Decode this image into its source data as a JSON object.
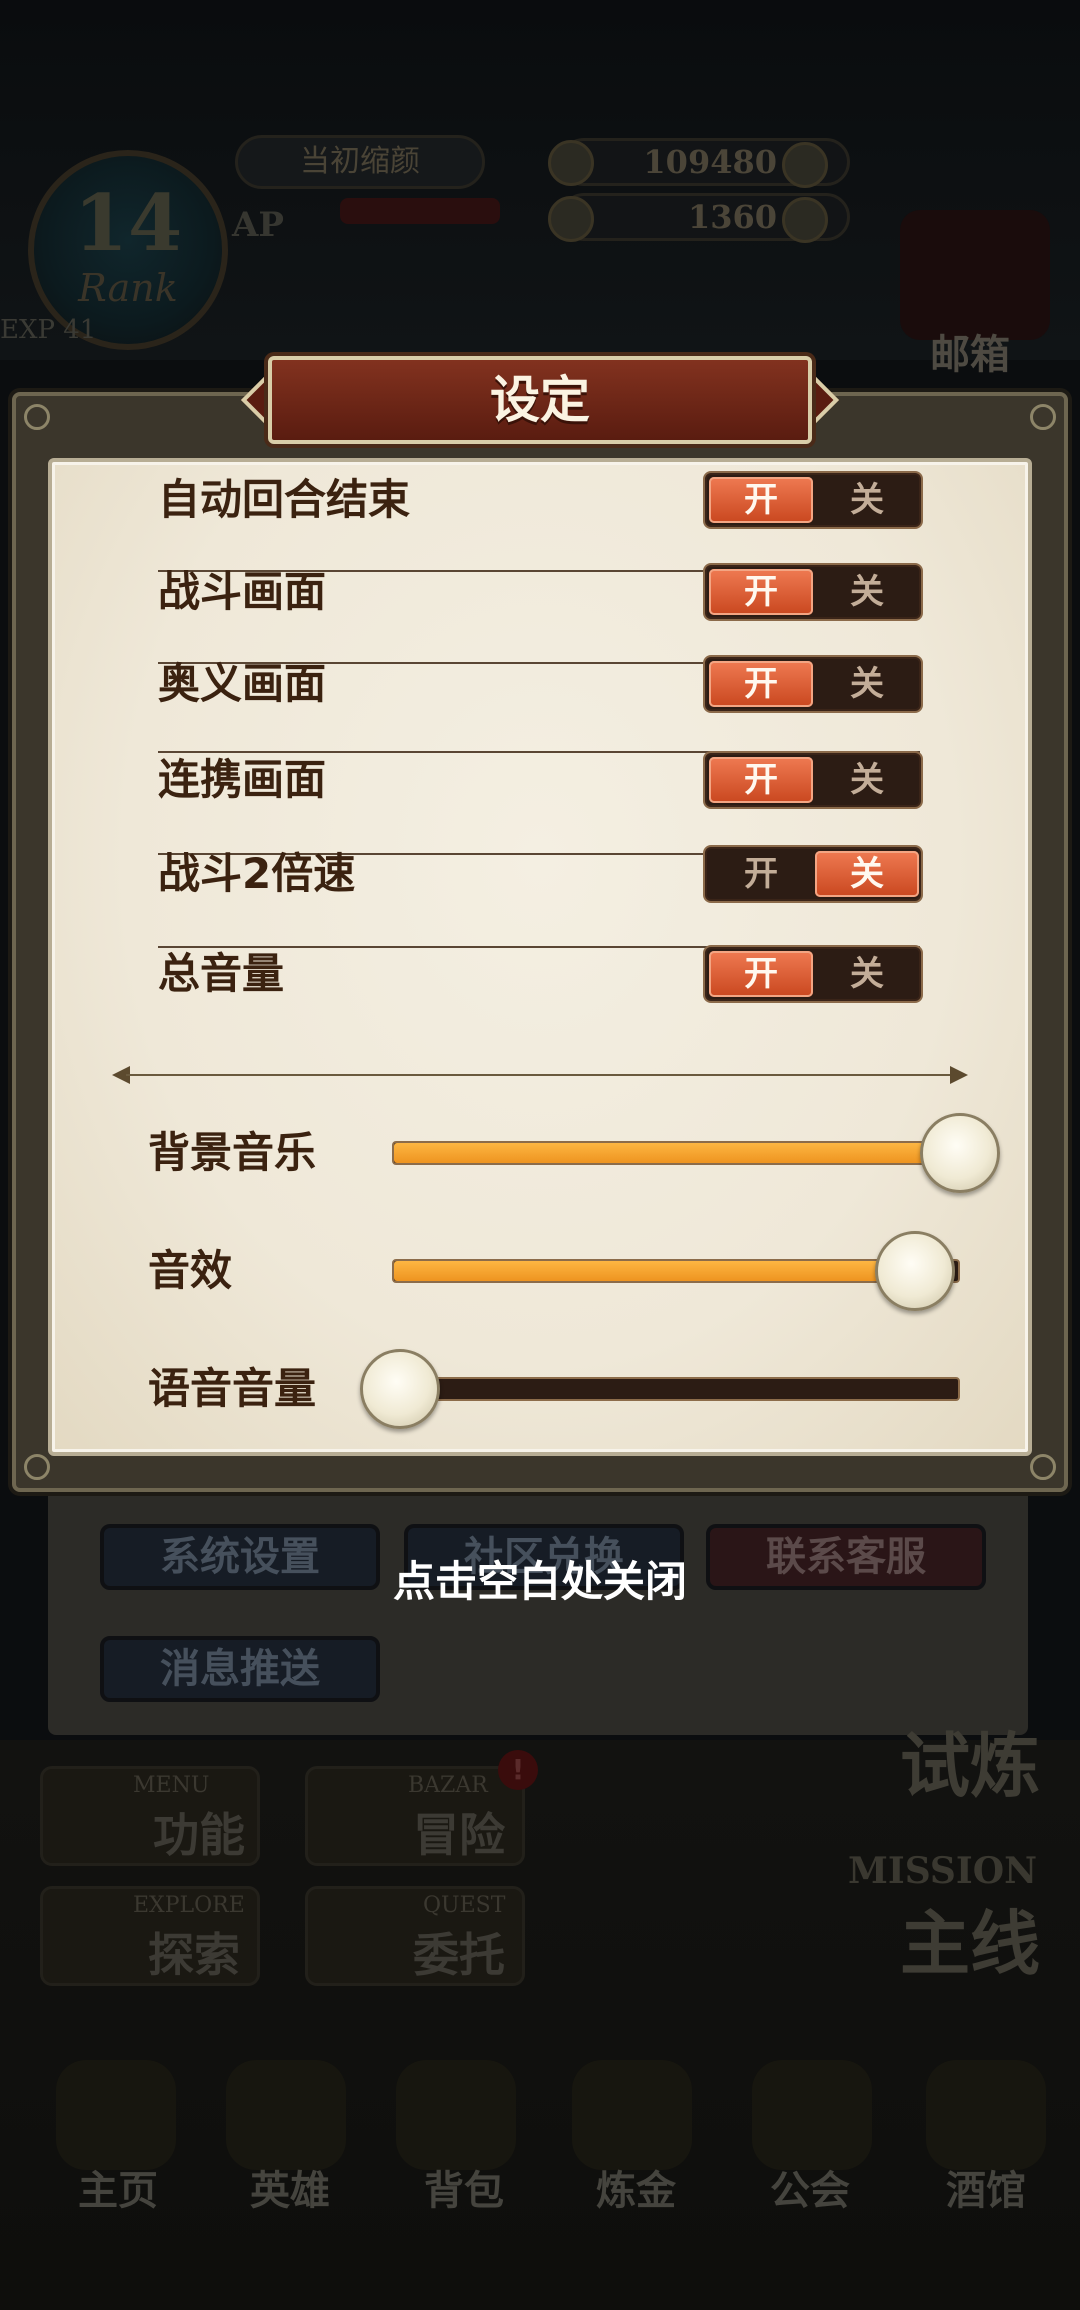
{
  "background": {
    "player": {
      "rank": "14",
      "rank_label": "Rank",
      "exp_label": "EXP 41",
      "name": "当初缩颜",
      "ap_label": "AP"
    },
    "currency": {
      "gold": "109480",
      "gems": "1360"
    },
    "mail_label": "邮箱",
    "buttons": {
      "system_settings": "系统设置",
      "community": "社区兑换",
      "contact_support": "联系客服",
      "push_notifications": "消息推送"
    },
    "menus": {
      "function": {
        "en": "MENU",
        "cn": "功能"
      },
      "adventure": {
        "en": "BAZAR",
        "cn": "冒险"
      },
      "explore": {
        "en": "EXPLORE",
        "cn": "探索"
      },
      "commission": {
        "en": "QUEST",
        "cn": "委托"
      },
      "mission": {
        "en": "MISSION",
        "cn": "主线"
      },
      "training": {
        "cn": "试炼"
      }
    },
    "nav": [
      "主页",
      "英雄",
      "背包",
      "炼金",
      "公会",
      "酒馆"
    ]
  },
  "dialog": {
    "title": "设定",
    "toggle_on_label": "开",
    "toggle_off_label": "关",
    "toggles": [
      {
        "label": "自动回合结束",
        "state": "on"
      },
      {
        "label": "战斗画面",
        "state": "on"
      },
      {
        "label": "奥义画面",
        "state": "on"
      },
      {
        "label": "连携画面",
        "state": "on"
      },
      {
        "label": "战斗2倍速",
        "state": "off"
      },
      {
        "label": "总音量",
        "state": "on"
      }
    ],
    "sliders": [
      {
        "label": "背景音乐",
        "value": 1.0
      },
      {
        "label": "音效",
        "value": 0.92
      },
      {
        "label": "语音音量",
        "value": 0.0
      }
    ]
  },
  "hint": "点击空白处关闭",
  "colors": {
    "toggle_active": "#e0603a",
    "slider_fill": "#f5a532",
    "title_plate": "#6e2616"
  }
}
